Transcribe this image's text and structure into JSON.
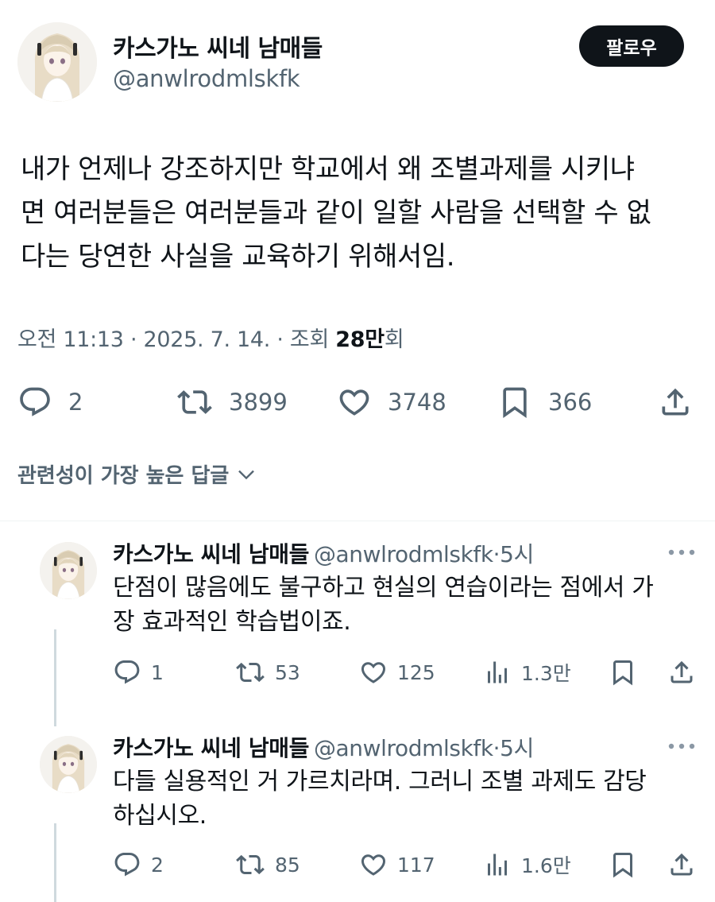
{
  "tweet": {
    "author_name": "카스가노 씨네 남매들",
    "author_handle": "@anwlrodmlskfk",
    "follow_label": "팔로우",
    "text_lines": [
      "내가 언제나 강조하지만 학교에서 왜 조별과제를 시키냐",
      "면 여러분들은 여러분들과 같이 일할 사람을 선택할 수 없",
      "다는 당연한 사실을 교육하기 위해서임."
    ],
    "meta_prefix": "오전 11:13 · 2025. 7. 14. · 조회 ",
    "meta_views": "28만",
    "meta_suffix": "회",
    "stats": {
      "replies": "2",
      "retweets": "3899",
      "likes": "3748",
      "bookmarks": "366"
    }
  },
  "sort_label": "관련성이 가장 높은 답글",
  "replies": [
    {
      "name": "카스가노 씨네 남매들",
      "handle": "@anwlrodmlskfk",
      "dot": "·",
      "time": "5시",
      "text_lines": [
        "단점이 많음에도 불구하고 현실의 연습이라는 점에서 가",
        "장 효과적인 학습법이죠."
      ],
      "replies": "1",
      "retweets": "53",
      "likes": "125",
      "views": "1.3만"
    },
    {
      "name": "카스가노 씨네 남매들",
      "handle": "@anwlrodmlskfk",
      "dot": "·",
      "time": "5시",
      "text_lines": [
        "다들 실용적인 거 가르치라며. 그러니 조별 과제도 감당",
        "하십시오."
      ],
      "replies": "2",
      "retweets": "85",
      "likes": "117",
      "views": "1.6만"
    }
  ],
  "icons": {
    "reply": "reply-icon",
    "retweet": "retweet-icon",
    "like": "heart-icon",
    "bookmark": "bookmark-icon",
    "share": "share-icon",
    "views": "views-icon",
    "more": "more-icon",
    "chevron": "chevron-down-icon"
  },
  "colors": {
    "text": "#0f1419",
    "secondary": "#536471",
    "follow_bg": "#0f1419",
    "thread_line": "#cfd9de"
  }
}
